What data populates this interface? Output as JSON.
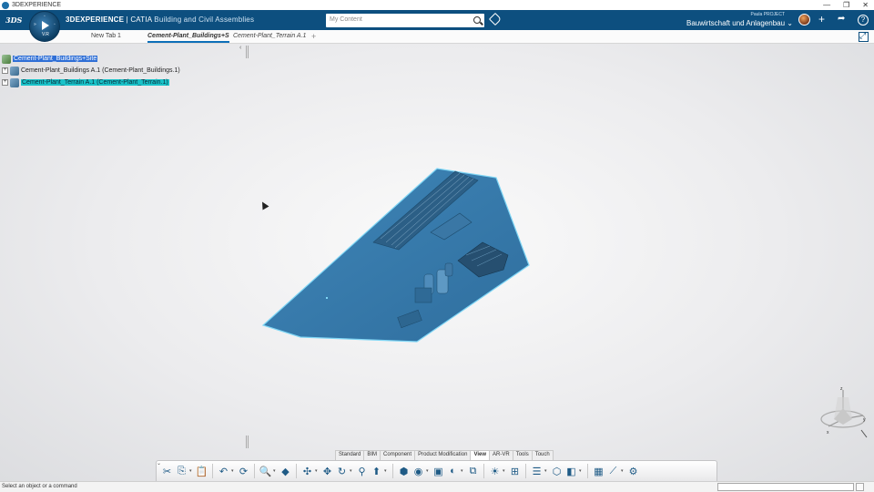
{
  "os": {
    "title": "3DEXPERIENCE",
    "controls": [
      "—",
      "❐",
      "✕"
    ]
  },
  "header": {
    "logo": "3DS",
    "compass_version": "V.R",
    "brand_bold": "3DEXPERIENCE",
    "brand_sep": " | CATIA",
    "brand_app": "Building and Civil Assemblies",
    "search_placeholder": "My Content",
    "project_owner": "Paula PROJECT",
    "project_name": "Bauwirtschaft und Anlagenbau ⌄",
    "icons": {
      "add": "+",
      "share": "➦",
      "help": "?"
    }
  },
  "tabs": {
    "items": [
      {
        "label": "New Tab 1"
      },
      {
        "label": "Cement-Plant_Buildings+S"
      },
      {
        "label": "Cement-Plant_Terrain A.1"
      }
    ],
    "add": "+"
  },
  "tree": {
    "collapse": "‹",
    "nodes": [
      {
        "label": "Cement-Plant_Buildings+Site",
        "exp": ""
      },
      {
        "label": "Cement-Plant_Buildings A.1 (Cement-Plant_Buildings.1)",
        "exp": "+"
      },
      {
        "label": "Cement-Plant_Terrain A.1 (Cement-Plant_Terrain.1)",
        "exp": "+"
      }
    ]
  },
  "compass_axes": {
    "z": "z",
    "y": "y",
    "x": "x"
  },
  "section_tabs": [
    "Standard",
    "BIM",
    "Component",
    "Product Modification",
    "View",
    "AR-VR",
    "Tools",
    "Touch"
  ],
  "active_section_tab": "View",
  "action_bar": {
    "collapse": "⌄",
    "commands": [
      "cut-icon",
      "copy-icon",
      "paste-icon",
      "undo-icon",
      "update-icon",
      "zoom-icon",
      "view-mode-icon",
      "fit-all-icon",
      "pan-icon",
      "rotate-icon",
      "zoom-area-icon",
      "normal-view-icon",
      "iso-view-icon",
      "render-style-icon",
      "capture-icon",
      "hide-show-icon",
      "swap-visible-icon",
      "lighting-icon",
      "multi-view-icon",
      "tree-expand-icon",
      "product-icon",
      "section-icon",
      "ar-icon",
      "measure-icon",
      "compass-tools-icon"
    ]
  },
  "status": {
    "text": "Select an object or a command"
  }
}
